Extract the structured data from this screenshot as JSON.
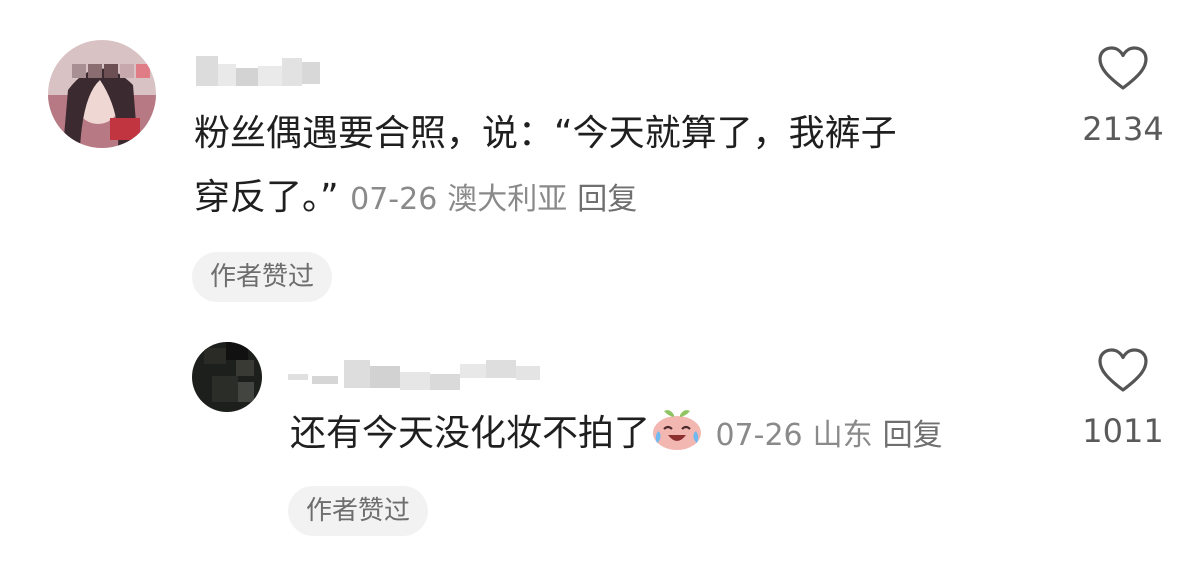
{
  "comments": [
    {
      "text_line1": "粉丝偶遇要合照，说：“今天就算了，我裤子",
      "text_line2": "穿反了。”",
      "date": "07-26",
      "location": "澳大利亚",
      "reply_label": "回复",
      "badge": "作者赞过",
      "likes": "2134"
    },
    {
      "text": "还有今天没化妆不拍了",
      "emoji": "crying-laughing-emoji",
      "date": "07-26",
      "location": "山东",
      "reply_label": "回复",
      "badge": "作者赞过",
      "likes": "1011"
    }
  ],
  "icons": {
    "like": "heart-outline-icon"
  },
  "colors": {
    "text": "#1f1f1f",
    "meta": "#8a8a8a",
    "badge_bg": "#f2f2f2"
  }
}
